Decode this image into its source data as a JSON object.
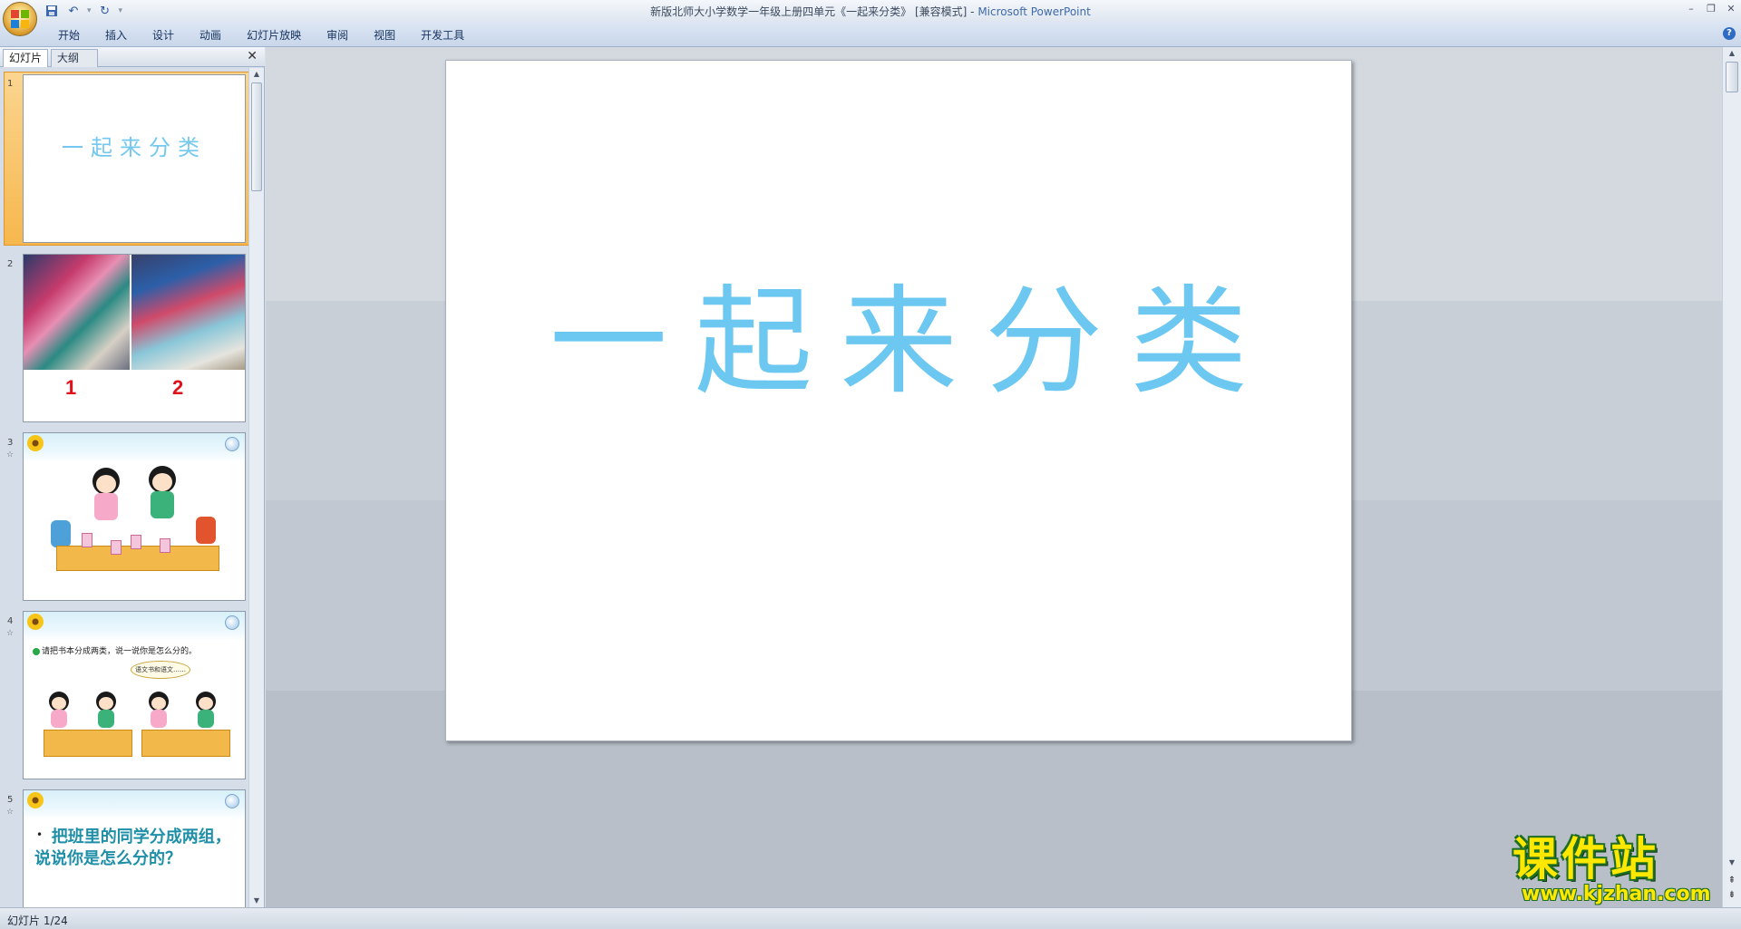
{
  "app": {
    "window_title": "新版北师大小学数学一年级上册四单元《一起来分类》 [兼容模式] - ",
    "app_name": "Microsoft PowerPoint"
  },
  "quick_access": {
    "items": [
      "save-icon",
      "undo-icon",
      "redo-icon",
      "customize-icon"
    ]
  },
  "ribbon": {
    "tabs": [
      "开始",
      "插入",
      "设计",
      "动画",
      "幻灯片放映",
      "审阅",
      "视图",
      "开发工具"
    ]
  },
  "left_pane": {
    "tabs": {
      "slides": "幻灯片",
      "outline": "大纲"
    },
    "close_glyph": "✕",
    "thumbnails": [
      {
        "number": "1",
        "title": "一起来分类"
      },
      {
        "number": "2",
        "label_a": "1",
        "label_b": "2"
      },
      {
        "number": "3"
      },
      {
        "number": "4",
        "instruction": "请把书本分成两类，说一说你是怎么分的。",
        "speech": "语文书和语文……"
      },
      {
        "number": "5",
        "bullet": "•",
        "text": "把班里的同学分成两组，说说你是怎么分的？"
      }
    ]
  },
  "slide": {
    "title": "一起来分类",
    "title_color": "#6cc8f1"
  },
  "watermark": {
    "main": "课件站",
    "url": "www.kjzhan.com"
  },
  "status": {
    "slide_indicator": "幻灯片 1/24"
  }
}
